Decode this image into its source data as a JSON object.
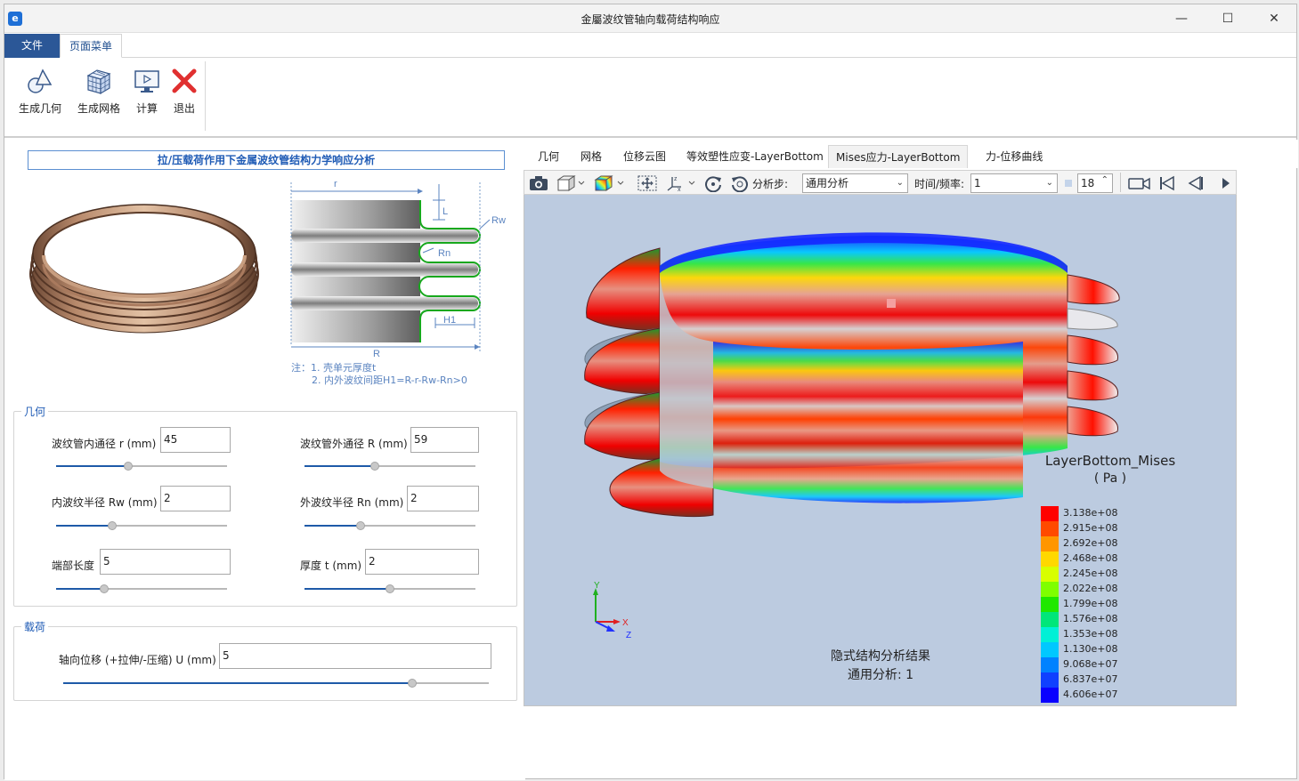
{
  "window": {
    "title": "金屬波纹管轴向载荷结构响应",
    "min_icon": "minimize-icon",
    "max_icon": "maximize-icon",
    "close_icon": "close-icon"
  },
  "menu": {
    "file": "文件",
    "page_menu": "页面菜单"
  },
  "ribbon": [
    {
      "label": "生成几何",
      "icon": "geometry-icon"
    },
    {
      "label": "生成网格",
      "icon": "mesh-icon"
    },
    {
      "label": "计算",
      "icon": "compute-icon"
    },
    {
      "label": "退出",
      "icon": "exit-icon"
    }
  ],
  "left": {
    "heading": "拉/压载荷作用下金属波纹管结构力学响应分析",
    "diagram": {
      "labels": {
        "r": "r",
        "L": "L",
        "Rw": "Rw",
        "Rn": "Rn",
        "H1": "H1",
        "R": "R"
      },
      "note1": "注：1. 壳单元厚度t",
      "note2": "2. 内外波纹间距H1=R-r-Rw-Rn>0"
    },
    "geometry": {
      "legend": "几何",
      "params": [
        {
          "label": "波纹管内通径 r (mm)",
          "value": "45",
          "level": 0.42
        },
        {
          "label": "波纹管外通径 R (mm)",
          "value": "59",
          "level": 0.41
        },
        {
          "label": "内波纹半径 Rw (mm)",
          "value": "2",
          "level": 0.33
        },
        {
          "label": "外波纹半径 Rn (mm)",
          "value": "2",
          "level": 0.33
        },
        {
          "label": "端部长度",
          "value": "5",
          "level": 0.28
        },
        {
          "label": "厚度 t (mm)",
          "value": "2",
          "level": 0.5
        }
      ]
    },
    "load": {
      "legend": "载荷",
      "label": "轴向位移 (+拉伸/-压缩) U (mm)",
      "value": "5",
      "level": 0.82
    }
  },
  "viewer": {
    "tabs": [
      "几何",
      "网格",
      "位移云图",
      "等效塑性应变-LayerBottom",
      "Mises应力-LayerBottom",
      "力-位移曲线"
    ],
    "active_tab": 4,
    "toolbar": {
      "step_label": "分析步:",
      "step_value": "通用分析",
      "time_label": "时间/频率:",
      "time_value": "1",
      "frame_value": "18"
    },
    "legend": {
      "title": "LayerBottom_Mises",
      "unit": "( Pa )",
      "values": [
        "3.138e+08",
        "2.915e+08",
        "2.692e+08",
        "2.468e+08",
        "2.245e+08",
        "2.022e+08",
        "1.799e+08",
        "1.576e+08",
        "1.353e+08",
        "1.130e+08",
        "9.068e+07",
        "6.837e+07",
        "4.606e+07"
      ],
      "colors": [
        "#ff0000",
        "#ff4a00",
        "#ff9600",
        "#ffd800",
        "#d8ff00",
        "#7fff00",
        "#20e800",
        "#00e67a",
        "#00f0d6",
        "#00c8ff",
        "#0082ff",
        "#1040ff",
        "#0a00ff"
      ]
    },
    "axes": {
      "x": "X",
      "y": "Y",
      "z": "Z"
    },
    "result_title": "隐式结构分析结果",
    "result_sub": "通用分析: 1"
  }
}
